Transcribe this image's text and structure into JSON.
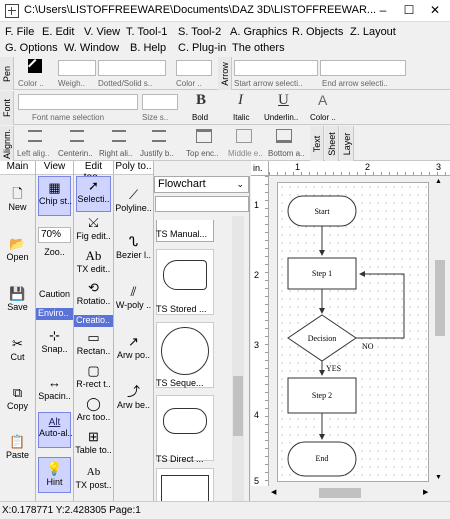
{
  "window": {
    "title": "C:\\Users\\LISTOFFREEWARE\\Documents\\DAZ 3D\\LISTOFFREEWAR...",
    "minimize": "–",
    "maximize": "☐",
    "close": "✕"
  },
  "menu": {
    "row1": [
      "F. File",
      "E. Edit",
      "V. View",
      "T. Tool-1",
      "S. Tool-2",
      "A. Graphics",
      "R. Objects",
      "Z. Layout"
    ],
    "row2": [
      "G. Options",
      "W. Window",
      "B. Help",
      "C. Plug-in",
      "The others"
    ]
  },
  "pen_toolbar": {
    "label": "Pen",
    "color_label": "Color ..",
    "weight_label": "Weigh..",
    "dotted_label": "Dotted/Solid s..",
    "fill_color_label": "Color ..",
    "arrow_label": "Arrow",
    "start_arrow": "Start arrow selecti..",
    "end_arrow": "End arrow selecti.."
  },
  "font_toolbar": {
    "label": "Font",
    "font_name": "Font name selection",
    "size": "Size s..",
    "bold_icon": "B",
    "bold": "Bold",
    "italic_icon": "I",
    "italic": "Italic",
    "underline_icon": "U",
    "underline": "Underlin..",
    "color_icon": "A",
    "color": "Color .."
  },
  "align_toolbar": {
    "label": "Alignm.",
    "buttons": [
      "Left alig..",
      "Centerin..",
      "Right ali..",
      "Justify b..",
      "Top enc..",
      "Middle e..",
      "Bottom a.."
    ],
    "tabs": [
      "Text",
      "Sheet",
      "Layer"
    ]
  },
  "main_col": {
    "header": "Main",
    "items": [
      "New",
      "Open",
      "Save",
      "Cut",
      "Copy",
      "Paste"
    ]
  },
  "view_col": {
    "header": "View",
    "chip": "Chip st..",
    "zoom_value": "70%",
    "zoom": "Zoo..",
    "caution": "Caution",
    "env_section": "Enviro..",
    "snap": "Snap..",
    "spacing": "Spacin..",
    "alt_icon": "Alt",
    "auto_align": "Auto-al..",
    "hint": "Hint"
  },
  "edit_col": {
    "header": "Edit too..",
    "items": [
      "Selecti..",
      "Fig edit..",
      "TX edit..",
      "Rotatio.."
    ],
    "create_section": "Creatio..",
    "create_items": [
      "Rectan..",
      "R-rect t..",
      "Arc too..",
      "Table to..",
      "TX post.."
    ]
  },
  "poly_col": {
    "header": "Poly to..",
    "items": [
      "Polyline..",
      "Bezier l..",
      "W-poly ..",
      "Arw po..",
      "Arw be.."
    ]
  },
  "flowchart_panel": {
    "selected": "Flowchart",
    "items": [
      "TS Manual...",
      "TS Stored ...",
      "TS Seque...",
      "TS Direct ..."
    ]
  },
  "ruler": {
    "unit": "in.",
    "top_ticks": [
      "1",
      "2",
      "3"
    ],
    "left_ticks": [
      "1",
      "2",
      "3",
      "4",
      "5"
    ]
  },
  "flowchart": {
    "start": "Start",
    "step1": "Step 1",
    "decision": "Decision",
    "no": "NO",
    "yes": "YES",
    "step2": "Step 2",
    "end": "End"
  },
  "status": {
    "text": "X:0.178771 Y:2.428305 Page:1"
  }
}
